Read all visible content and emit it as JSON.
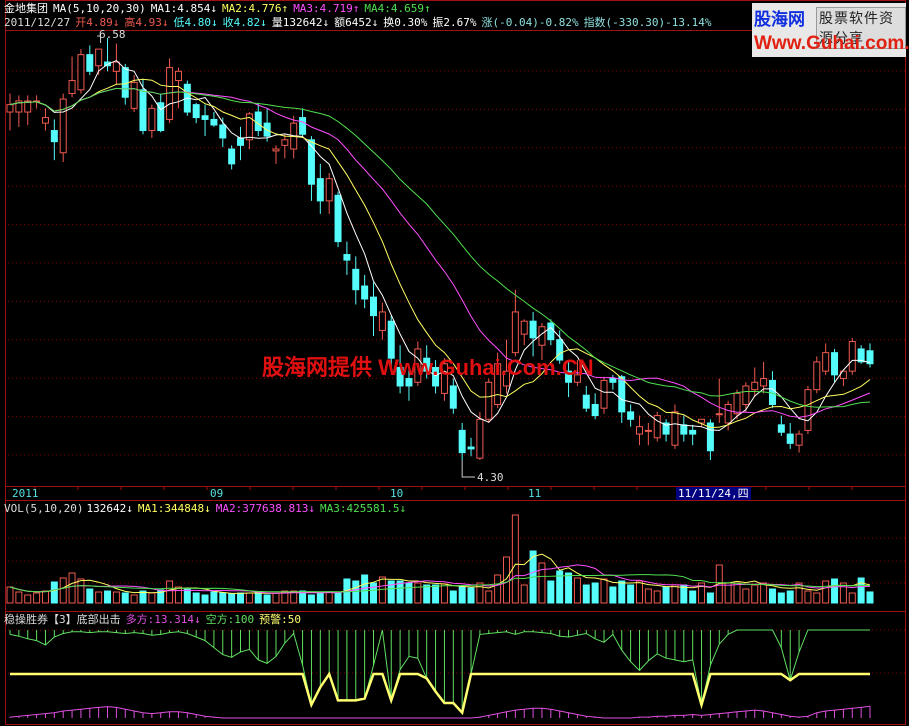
{
  "header": {
    "stock_name": "金地集团",
    "ma_label": "MA(5,10,20,30)",
    "ma1": "MA1:4.854↓",
    "ma2": "MA2:4.776↑",
    "ma3": "MA3:4.719↑",
    "ma4": "MA4:4.659↑",
    "date": "2011/12/27",
    "open": "开4.89↓",
    "high": "高4.93↓",
    "low": "低4.80↓",
    "close": "收4.82↓",
    "volume": "量132642↓",
    "amount": "额6452↓",
    "turnover": "换0.30%",
    "amplitude": "振2.67%",
    "change": "涨(-0.04)-0.82%",
    "index": "指数(-330.30)-13.14%"
  },
  "logo": {
    "brand": "股海网",
    "slogan": "股票软件资源分享",
    "url": "Www.Guhai.com.cn"
  },
  "watermark": "股海网提供 Www.Guhai.Com.CN",
  "annotations": {
    "max_label": "6.58",
    "min_label": "4.30"
  },
  "date_axis": {
    "labels": [
      "2011",
      "09",
      "10",
      "11"
    ],
    "cursor_date": "11/11/24,四"
  },
  "volume_panel": {
    "label": "VOL(5,10,20)",
    "value": "132642↓",
    "ma1": "MA1:344848↓",
    "ma2": "MA2:377638.813↓",
    "ma3": "MA3:425581.5↓"
  },
  "indicator_panel": {
    "name": "稳操胜券【3】底部出击",
    "duo": "多方:13.314↓",
    "kong": "空方:100",
    "warn": "预警:50"
  },
  "colors": {
    "up": "#f05a50",
    "down": "#54fcfc",
    "ma1": "#ffffff",
    "ma2": "#ffff60",
    "ma3": "#ff50ff",
    "ma4": "#50e050",
    "grid": "#8a0000",
    "border": "#a01010",
    "kong": "#60e060",
    "warn": "#ffff70",
    "duo": "#e050e0"
  },
  "chart_data": {
    "type": "candlestick",
    "ma_periods": [
      5,
      10,
      20,
      30
    ],
    "vol_ma_periods": [
      5,
      10,
      20
    ],
    "price_range": [
      4.3,
      6.58
    ],
    "candles": [
      [
        6.18,
        6.28,
        6.08,
        6.22
      ],
      [
        6.18,
        6.27,
        6.1,
        6.24
      ],
      [
        6.18,
        6.27,
        6.11,
        6.24
      ],
      [
        6.24,
        6.27,
        6.2,
        6.24
      ],
      [
        6.12,
        6.2,
        6.08,
        6.15
      ],
      [
        6.08,
        6.14,
        5.92,
        6.02
      ],
      [
        5.96,
        6.28,
        5.91,
        6.25
      ],
      [
        6.28,
        6.48,
        6.26,
        6.35
      ],
      [
        6.3,
        6.52,
        6.28,
        6.49
      ],
      [
        6.49,
        6.54,
        6.38,
        6.4
      ],
      [
        6.43,
        6.52,
        6.38,
        6.52
      ],
      [
        6.45,
        6.58,
        6.4,
        6.43
      ],
      [
        6.4,
        6.55,
        6.33,
        6.45
      ],
      [
        6.42,
        6.44,
        6.22,
        6.26
      ],
      [
        6.2,
        6.38,
        6.18,
        6.34
      ],
      [
        6.3,
        6.36,
        6.06,
        6.08
      ],
      [
        6.08,
        6.22,
        6.04,
        6.2
      ],
      [
        6.23,
        6.28,
        6.07,
        6.08
      ],
      [
        6.14,
        6.47,
        6.12,
        6.42
      ],
      [
        6.35,
        6.42,
        6.2,
        6.4
      ],
      [
        6.33,
        6.35,
        6.16,
        6.18
      ],
      [
        6.22,
        6.23,
        6.12,
        6.15
      ],
      [
        6.16,
        6.22,
        6.05,
        6.14
      ],
      [
        6.14,
        6.18,
        6.1,
        6.11
      ],
      [
        6.11,
        6.15,
        5.99,
        6.04
      ],
      [
        5.98,
        6.0,
        5.87,
        5.9
      ],
      [
        6.04,
        6.1,
        5.92,
        6.0
      ],
      [
        6.03,
        6.18,
        5.98,
        6.17
      ],
      [
        6.18,
        6.23,
        6.05,
        6.08
      ],
      [
        6.12,
        6.2,
        6.02,
        6.05
      ],
      [
        5.97,
        6.0,
        5.9,
        5.98
      ],
      [
        6.0,
        6.06,
        5.93,
        6.03
      ],
      [
        5.98,
        6.16,
        5.93,
        6.12
      ],
      [
        6.15,
        6.2,
        6.05,
        6.06
      ],
      [
        6.03,
        6.05,
        5.7,
        5.79
      ],
      [
        5.82,
        5.9,
        5.63,
        5.7
      ],
      [
        5.7,
        5.85,
        5.63,
        5.82
      ],
      [
        5.73,
        5.75,
        5.45,
        5.48
      ],
      [
        5.41,
        5.48,
        5.3,
        5.38
      ],
      [
        5.33,
        5.4,
        5.14,
        5.22
      ],
      [
        5.24,
        5.3,
        5.12,
        5.17
      ],
      [
        5.18,
        5.26,
        4.97,
        5.08
      ],
      [
        5.0,
        5.15,
        4.95,
        5.1
      ],
      [
        5.05,
        5.08,
        4.8,
        4.85
      ],
      [
        4.8,
        4.92,
        4.66,
        4.7
      ],
      [
        4.74,
        4.8,
        4.62,
        4.7
      ],
      [
        4.72,
        4.94,
        4.7,
        4.9
      ],
      [
        4.85,
        4.92,
        4.74,
        4.78
      ],
      [
        4.8,
        4.84,
        4.66,
        4.7
      ],
      [
        4.66,
        4.85,
        4.62,
        4.82
      ],
      [
        4.7,
        4.74,
        4.55,
        4.58
      ],
      [
        4.46,
        4.5,
        4.3,
        4.34
      ],
      [
        4.37,
        4.42,
        4.32,
        4.36
      ],
      [
        4.31,
        4.56,
        4.3,
        4.52
      ],
      [
        4.52,
        4.74,
        4.5,
        4.72
      ],
      [
        4.6,
        4.88,
        4.58,
        4.82
      ],
      [
        4.7,
        4.95,
        4.66,
        4.78
      ],
      [
        4.88,
        5.22,
        4.86,
        5.1
      ],
      [
        4.98,
        5.06,
        4.92,
        5.05
      ],
      [
        5.05,
        5.1,
        4.86,
        4.96
      ],
      [
        4.92,
        5.04,
        4.84,
        5.02
      ],
      [
        5.04,
        5.06,
        4.92,
        4.95
      ],
      [
        4.95,
        5.0,
        4.82,
        4.84
      ],
      [
        4.78,
        4.84,
        4.64,
        4.72
      ],
      [
        4.72,
        4.84,
        4.7,
        4.76
      ],
      [
        4.65,
        4.7,
        4.56,
        4.58
      ],
      [
        4.6,
        4.66,
        4.52,
        4.54
      ],
      [
        4.58,
        4.75,
        4.55,
        4.73
      ],
      [
        4.74,
        4.76,
        4.68,
        4.72
      ],
      [
        4.75,
        4.76,
        4.5,
        4.56
      ],
      [
        4.56,
        4.6,
        4.48,
        4.52
      ],
      [
        4.44,
        4.54,
        4.38,
        4.48
      ],
      [
        4.46,
        4.5,
        4.38,
        4.46
      ],
      [
        4.42,
        4.56,
        4.4,
        4.54
      ],
      [
        4.5,
        4.52,
        4.4,
        4.44
      ],
      [
        4.38,
        4.6,
        4.36,
        4.56
      ],
      [
        4.49,
        4.54,
        4.4,
        4.44
      ],
      [
        4.46,
        4.49,
        4.38,
        4.44
      ],
      [
        4.5,
        4.52,
        4.48,
        4.52
      ],
      [
        4.5,
        4.52,
        4.3,
        4.35
      ],
      [
        4.55,
        4.74,
        4.5,
        4.55
      ],
      [
        4.5,
        4.62,
        4.46,
        4.6
      ],
      [
        4.55,
        4.68,
        4.52,
        4.66
      ],
      [
        4.6,
        4.72,
        4.56,
        4.7
      ],
      [
        4.68,
        4.8,
        4.64,
        4.72
      ],
      [
        4.7,
        4.83,
        4.66,
        4.74
      ],
      [
        4.73,
        4.78,
        4.58,
        4.6
      ],
      [
        4.49,
        4.54,
        4.43,
        4.45
      ],
      [
        4.44,
        4.5,
        4.36,
        4.39
      ],
      [
        4.38,
        4.46,
        4.34,
        4.44
      ],
      [
        4.46,
        4.7,
        4.44,
        4.68
      ],
      [
        4.68,
        4.86,
        4.66,
        4.83
      ],
      [
        4.78,
        4.93,
        4.76,
        4.88
      ],
      [
        4.88,
        4.9,
        4.72,
        4.76
      ],
      [
        4.74,
        4.78,
        4.7,
        4.78
      ],
      [
        4.78,
        4.96,
        4.76,
        4.94
      ],
      [
        4.9,
        4.92,
        4.82,
        4.83
      ],
      [
        4.89,
        4.93,
        4.8,
        4.82
      ]
    ],
    "volumes": [
      192000,
      132000,
      96000,
      120000,
      144000,
      252000,
      300000,
      360000,
      288000,
      168000,
      132000,
      144000,
      132000,
      120000,
      96000,
      144000,
      120000,
      156000,
      264000,
      192000,
      168000,
      120000,
      96000,
      132000,
      120000,
      108000,
      120000,
      120000,
      132000,
      96000,
      120000,
      144000,
      144000,
      144000,
      96000,
      120000,
      132000,
      120000,
      288000,
      264000,
      336000,
      240000,
      312000,
      264000,
      264000,
      240000,
      240000,
      216000,
      216000,
      228000,
      144000,
      192000,
      180000,
      240000,
      144000,
      336000,
      552000,
      1056000,
      216000,
      624000,
      480000,
      264000,
      384000,
      360000,
      300000,
      216000,
      240000,
      288000,
      192000,
      264000,
      216000,
      264000,
      168000,
      144000,
      192000,
      216000,
      216000,
      144000,
      240000,
      120000,
      456000,
      240000,
      240000,
      168000,
      216000,
      240000,
      168000,
      120000,
      144000,
      240000,
      144000,
      120000,
      264000,
      288000,
      240000,
      120000,
      300000,
      132642
    ],
    "volume_max": 1080000,
    "kong": [
      95,
      93,
      90,
      88,
      83,
      92,
      96,
      98,
      98,
      97,
      98,
      98,
      97,
      96,
      97,
      96,
      94,
      95,
      97,
      98,
      96,
      92,
      88,
      80,
      72,
      69,
      75,
      78,
      66,
      62,
      70,
      85,
      96,
      60,
      15,
      35,
      50,
      20,
      20,
      20,
      22,
      60,
      100,
      20,
      55,
      70,
      68,
      45,
      30,
      17,
      17,
      6,
      50,
      95,
      96,
      97,
      98,
      95,
      98,
      98,
      97,
      96,
      93,
      92,
      94,
      96,
      90,
      86,
      95,
      77,
      64,
      54,
      65,
      73,
      68,
      66,
      64,
      66,
      15,
      60,
      84,
      95,
      100,
      100,
      100,
      100,
      100,
      80,
      43,
      75,
      100,
      100,
      100,
      100,
      100,
      100,
      100,
      100
    ],
    "duo": [
      1,
      2,
      3,
      4,
      5,
      6,
      8,
      9,
      10,
      11,
      12,
      13,
      12,
      10,
      8,
      6,
      5,
      6,
      7,
      7,
      6,
      4,
      2,
      1,
      0,
      0,
      0,
      0,
      0,
      0,
      0,
      0,
      0,
      0,
      0,
      0,
      0,
      0,
      0,
      0,
      0,
      0,
      0,
      0,
      0,
      0,
      0,
      0,
      0,
      0,
      0,
      0,
      0,
      1,
      3,
      5,
      7,
      9,
      10,
      11,
      11,
      10,
      8,
      6,
      4,
      2,
      1,
      0,
      0,
      0,
      0,
      1,
      1,
      2,
      2,
      3,
      3,
      4,
      3,
      4,
      5,
      6,
      7,
      8,
      9,
      8,
      6,
      4,
      2,
      1,
      2,
      6,
      8,
      9,
      10,
      11,
      12,
      13.314
    ],
    "warn_level": 50
  }
}
